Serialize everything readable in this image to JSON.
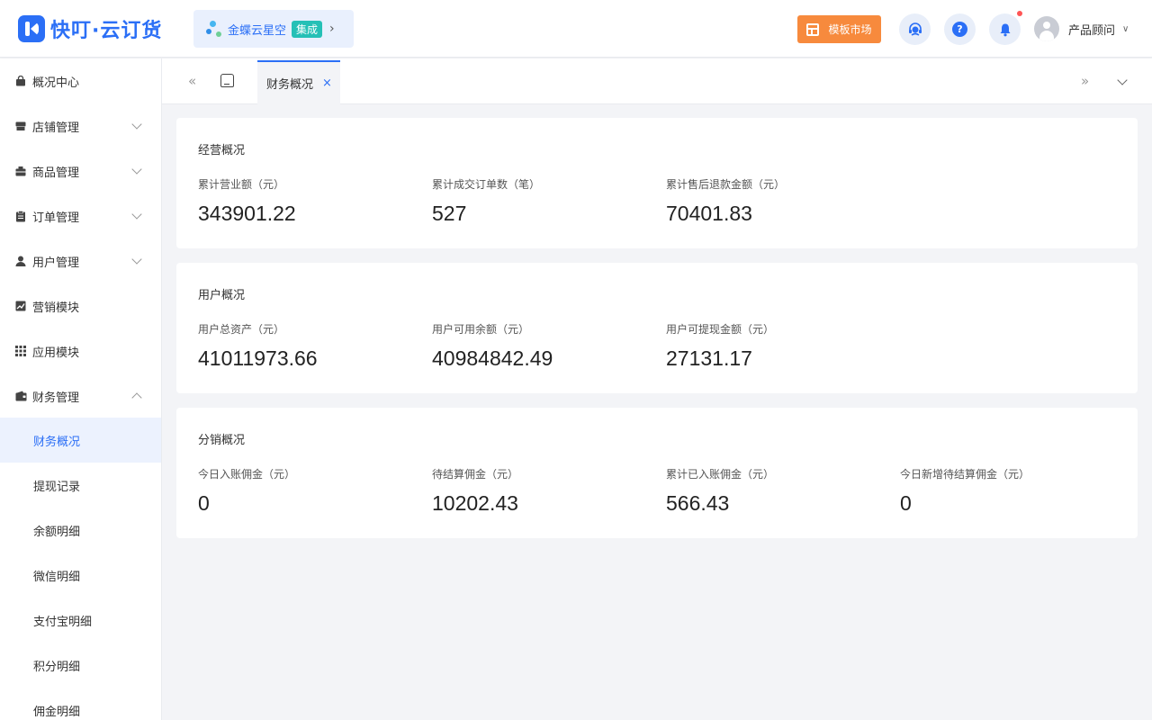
{
  "header": {
    "logo_text": "快叮·云订货",
    "integration": {
      "label": "金蝶云星空",
      "badge": "集成"
    },
    "market_button": "模板市场",
    "user_name": "产品顾问"
  },
  "sidebar": {
    "items": [
      {
        "label": "概况中心"
      },
      {
        "label": "店铺管理"
      },
      {
        "label": "商品管理"
      },
      {
        "label": "订单管理"
      },
      {
        "label": "用户管理"
      },
      {
        "label": "营销模块"
      },
      {
        "label": "应用模块"
      },
      {
        "label": "财务管理"
      }
    ],
    "sub_items": [
      {
        "label": "财务概况"
      },
      {
        "label": "提现记录"
      },
      {
        "label": "余额明细"
      },
      {
        "label": "微信明细"
      },
      {
        "label": "支付宝明细"
      },
      {
        "label": "积分明细"
      },
      {
        "label": "佣金明细"
      }
    ]
  },
  "tabs": {
    "active_label": "财务概况",
    "close_symbol": "×"
  },
  "cards": [
    {
      "title": "经营概况",
      "stats": [
        {
          "label": "累计营业额（元）",
          "value": "343901.22"
        },
        {
          "label": "累计成交订单数（笔）",
          "value": "527"
        },
        {
          "label": "累计售后退款金额（元）",
          "value": "70401.83"
        }
      ]
    },
    {
      "title": "用户概况",
      "stats": [
        {
          "label": "用户总资产（元）",
          "value": "41011973.66"
        },
        {
          "label": "用户可用余额（元）",
          "value": "40984842.49"
        },
        {
          "label": "用户可提现金额（元）",
          "value": "27131.17"
        }
      ]
    },
    {
      "title": "分销概况",
      "stats": [
        {
          "label": "今日入账佣金（元）",
          "value": "0"
        },
        {
          "label": "待结算佣金（元）",
          "value": "10202.43"
        },
        {
          "label": "累计已入账佣金（元）",
          "value": "566.43"
        },
        {
          "label": "今日新增待结算佣金（元）",
          "value": "0"
        }
      ]
    }
  ],
  "colors": {
    "accent": "#2b6ff6",
    "market_orange": "#f78a3d",
    "badge_teal": "#25c0b6",
    "notification_dot": "#ff5555"
  }
}
